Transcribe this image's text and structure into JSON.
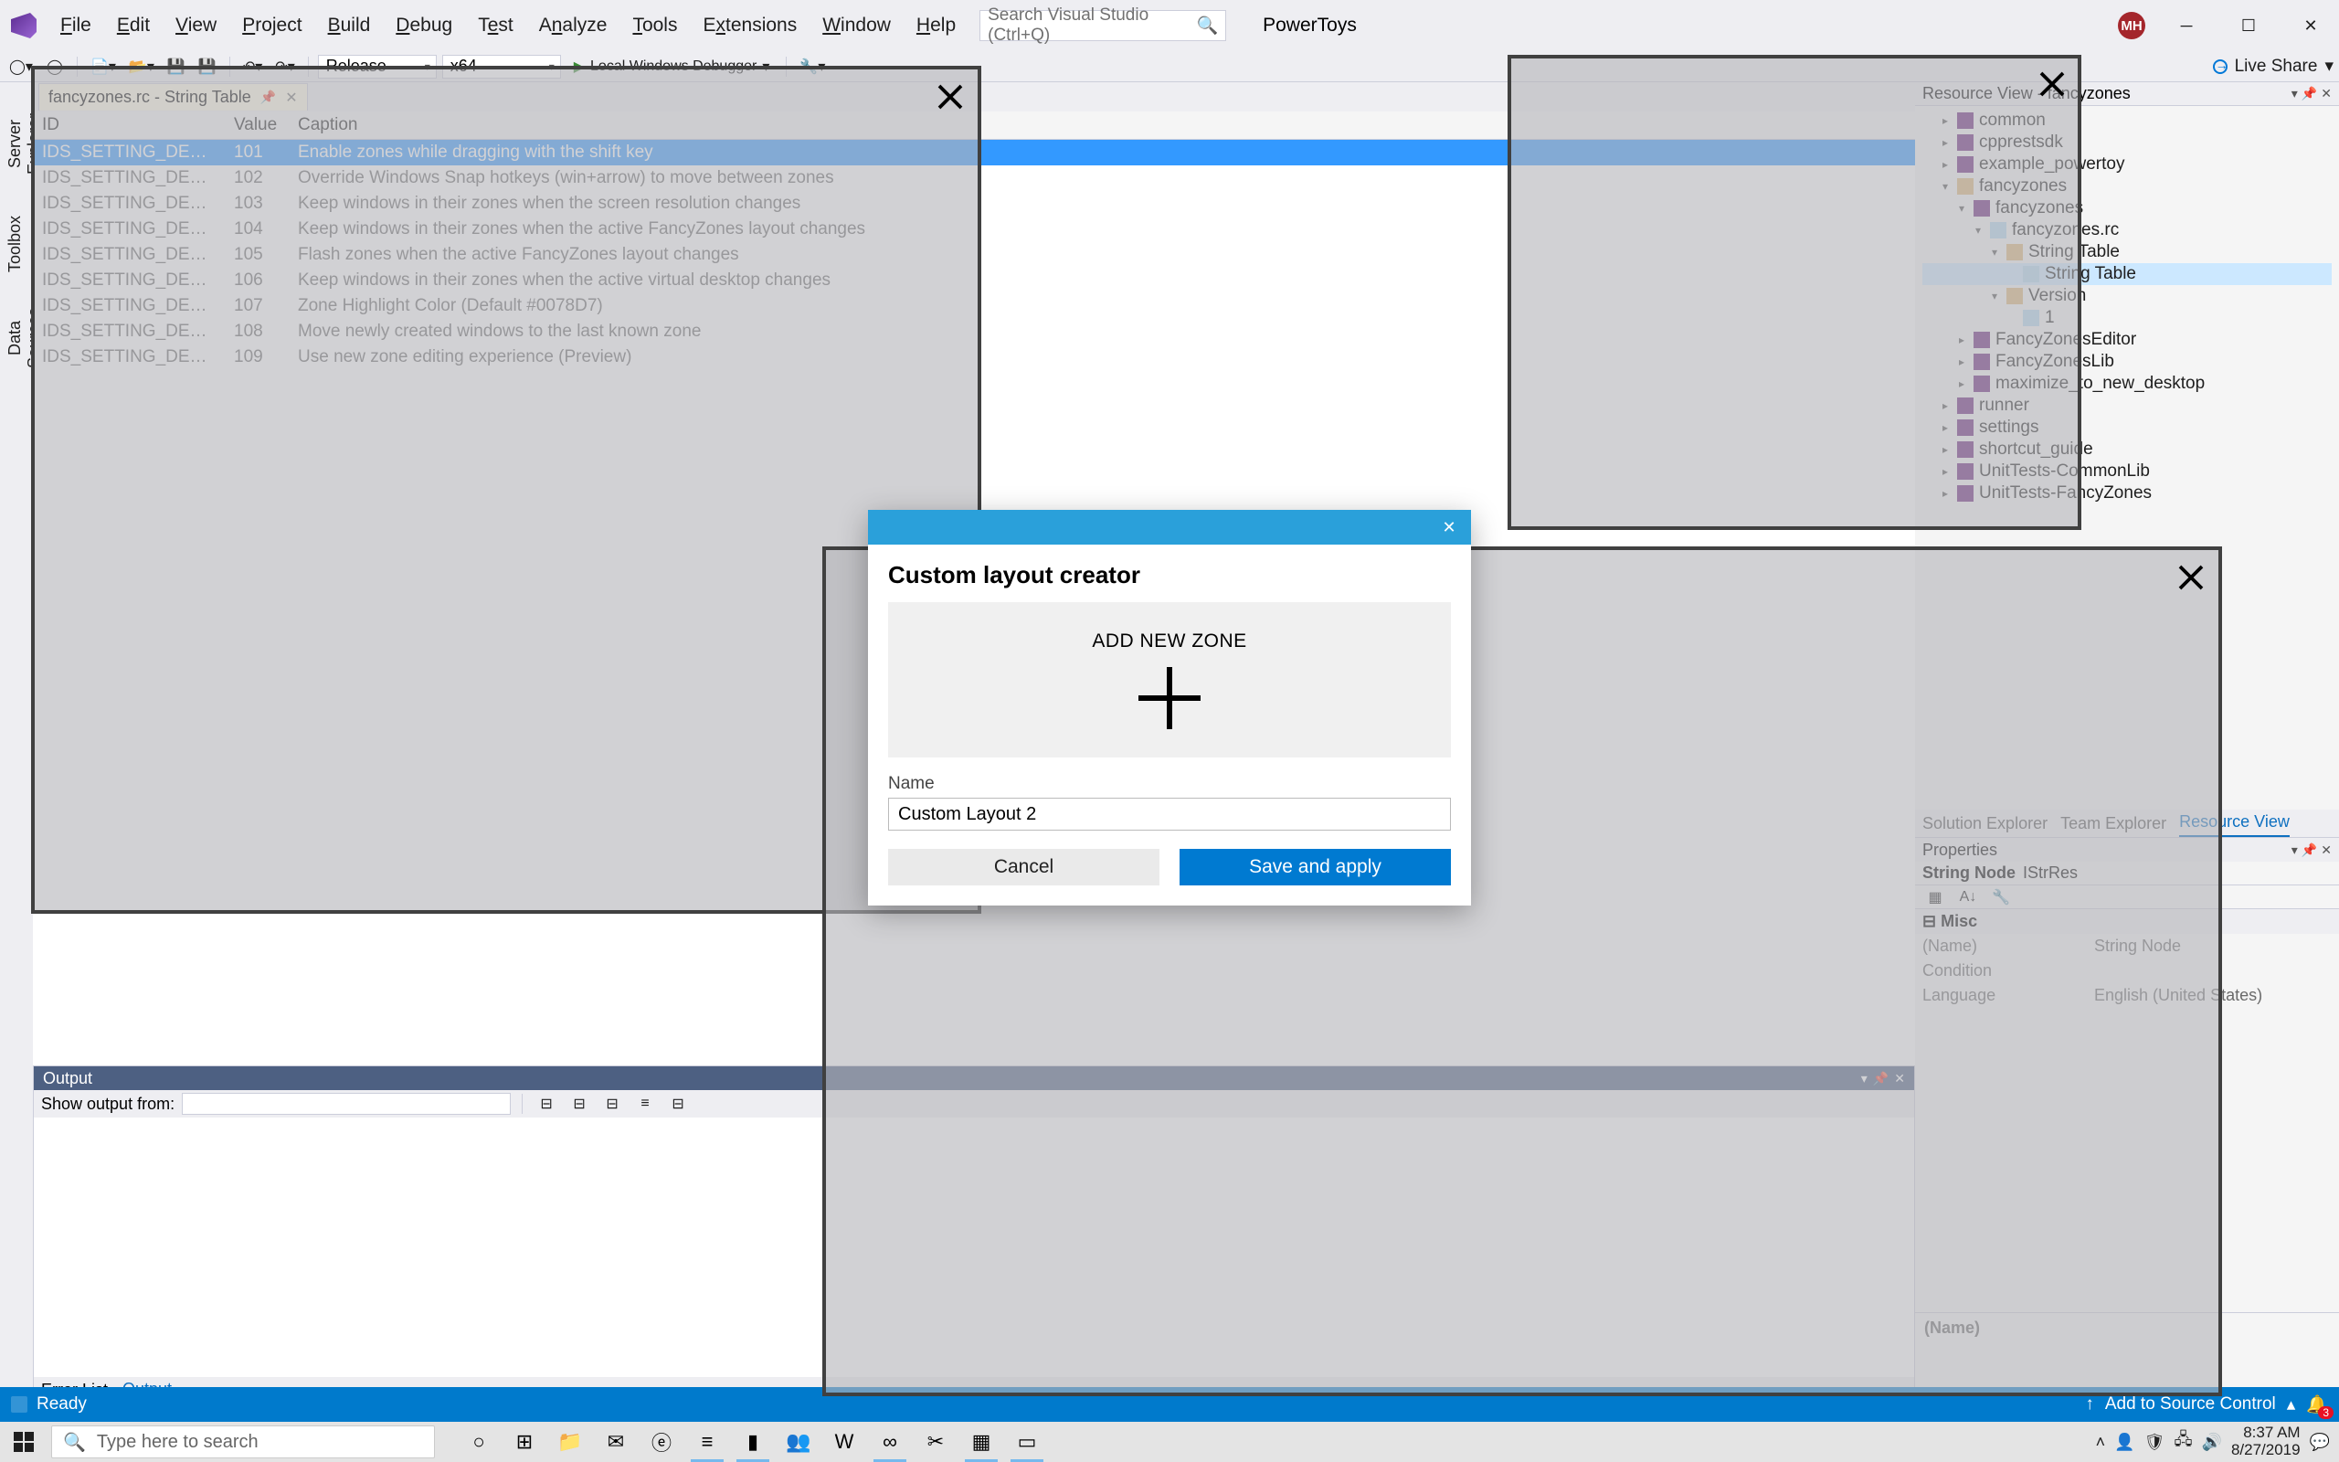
{
  "menu": [
    "File",
    "Edit",
    "View",
    "Project",
    "Build",
    "Debug",
    "Test",
    "Analyze",
    "Tools",
    "Extensions",
    "Window",
    "Help"
  ],
  "search_placeholder": "Search Visual Studio (Ctrl+Q)",
  "app_label": "PowerToys",
  "avatar": "MH",
  "live_share": "Live Share",
  "toolbar": {
    "config": "Release",
    "platform": "x64",
    "debug": "Local Windows Debugger"
  },
  "left_rail": [
    "Server Explorer",
    "Toolbox",
    "Data Sources"
  ],
  "doc_tab": "fancyzones.rc - String Table",
  "string_table": {
    "headers": [
      "ID",
      "Value",
      "Caption"
    ],
    "rows": [
      {
        "id": "IDS_SETTING_DESCRIPTION_...",
        "val": "101",
        "cap": "Enable zones while dragging with the shift key",
        "sel": true
      },
      {
        "id": "IDS_SETTING_DESCRIPTION_...",
        "val": "102",
        "cap": "Override Windows Snap hotkeys (win+arrow) to move between zones"
      },
      {
        "id": "IDS_SETTING_DESCRIPTION_...",
        "val": "103",
        "cap": "Keep windows in their zones when the screen resolution changes"
      },
      {
        "id": "IDS_SETTING_DESCRIPTION_...",
        "val": "104",
        "cap": "Keep windows in their zones when the active FancyZones layout changes"
      },
      {
        "id": "IDS_SETTING_DESCRIPTION_...",
        "val": "105",
        "cap": "Flash zones when the active FancyZones layout changes"
      },
      {
        "id": "IDS_SETTING_DESCRIPTION_...",
        "val": "106",
        "cap": "Keep windows in their zones when the active virtual desktop changes"
      },
      {
        "id": "IDS_SETTING_DESCRIPTION_...",
        "val": "107",
        "cap": "Zone Highlight Color (Default #0078D7)"
      },
      {
        "id": "IDS_SETTING_DESCRIPTION_...",
        "val": "108",
        "cap": "Move newly created windows to the last known zone"
      },
      {
        "id": "IDS_SETTING_DESCRIPTION_...",
        "val": "109",
        "cap": "Use new zone editing experience (Preview)"
      }
    ]
  },
  "output": {
    "title": "Output",
    "show_from": "Show output from:"
  },
  "bottom_tabs": {
    "error_list": "Error List",
    "output": "Output"
  },
  "solution": {
    "title": "Resource View - fancyzones",
    "nodes": [
      {
        "d": 1,
        "exp": "▸",
        "ic": "proj",
        "label": "common"
      },
      {
        "d": 1,
        "exp": "▸",
        "ic": "proj",
        "label": "cpprestsdk"
      },
      {
        "d": 1,
        "exp": "▸",
        "ic": "proj",
        "label": "example_powertoy"
      },
      {
        "d": 1,
        "exp": "▾",
        "ic": "folder",
        "label": "fancyzones"
      },
      {
        "d": 2,
        "exp": "▾",
        "ic": "proj",
        "label": "fancyzones"
      },
      {
        "d": 3,
        "exp": "▾",
        "ic": "file",
        "label": "fancyzones.rc"
      },
      {
        "d": 4,
        "exp": "▾",
        "ic": "folder",
        "label": "String Table"
      },
      {
        "d": 5,
        "exp": "",
        "ic": "file",
        "label": "String Table",
        "sel": true
      },
      {
        "d": 4,
        "exp": "▾",
        "ic": "folder",
        "label": "Version"
      },
      {
        "d": 5,
        "exp": "",
        "ic": "file",
        "label": "1"
      },
      {
        "d": 2,
        "exp": "▸",
        "ic": "proj",
        "label": "FancyZonesEditor"
      },
      {
        "d": 2,
        "exp": "▸",
        "ic": "proj",
        "label": "FancyZonesLib"
      },
      {
        "d": 2,
        "exp": "▸",
        "ic": "proj",
        "label": "maximize_to_new_desktop"
      },
      {
        "d": 1,
        "exp": "▸",
        "ic": "proj",
        "label": "runner"
      },
      {
        "d": 1,
        "exp": "▸",
        "ic": "proj",
        "label": "settings"
      },
      {
        "d": 1,
        "exp": "▸",
        "ic": "proj",
        "label": "shortcut_guide"
      },
      {
        "d": 1,
        "exp": "▸",
        "ic": "proj",
        "label": "UnitTests-CommonLib"
      },
      {
        "d": 1,
        "exp": "▸",
        "ic": "proj",
        "label": "UnitTests-FancyZones"
      }
    ]
  },
  "right_tabs": [
    "Solution Explorer",
    "Team Explorer",
    "Resource View"
  ],
  "properties": {
    "title": "Properties",
    "type_bold": "String Node",
    "type_rest": "IStrRes",
    "cat": "Misc",
    "rows": [
      {
        "k": "(Name)",
        "v": "String Node"
      },
      {
        "k": "Condition",
        "v": ""
      },
      {
        "k": "Language",
        "v": "English (United States)"
      }
    ],
    "desc_title": "(Name)"
  },
  "statusbar": {
    "ready": "Ready",
    "source": "Add to Source Control"
  },
  "taskbar": {
    "search": "Type here to search",
    "time": "8:37 AM",
    "date": "8/27/2019"
  },
  "dialog": {
    "title": "Custom layout creator",
    "add": "ADD NEW ZONE",
    "name_label": "Name",
    "name_value": "Custom Layout 2",
    "cancel": "Cancel",
    "save": "Save and apply"
  }
}
